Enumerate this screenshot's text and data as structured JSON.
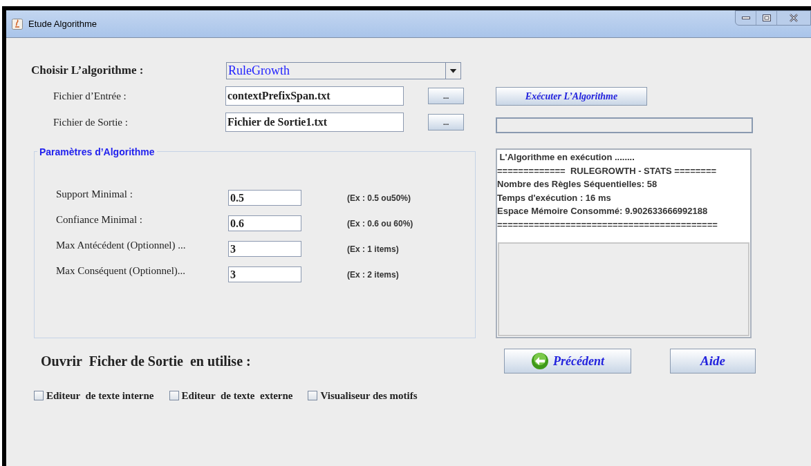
{
  "window": {
    "title": "Etude Algorithme"
  },
  "algorithm": {
    "label": "Choisir L’algorithme :",
    "value": "RuleGrowth"
  },
  "input_file": {
    "label": "Fichier d’Entrée :",
    "value": "contextPrefixSpan.txt",
    "browse": "..."
  },
  "output_file": {
    "label": "Fichier de Sortie :",
    "value": "Fichier de Sortie1.txt",
    "browse": "..."
  },
  "run_button": "Exécuter L’Algorithme",
  "parameters": {
    "title": "Paramètres d’Algorithme",
    "rows": [
      {
        "label": "Support Minimal :",
        "value": "0.5",
        "hint": "(Ex : 0.5 ou50%)"
      },
      {
        "label": "Confiance Minimal :",
        "value": "0.6",
        "hint": "(Ex : 0.6 ou 60%)"
      },
      {
        "label": "Max Antécédent (Optionnel) ...",
        "value": "3",
        "hint": "(Ex : 1 items)"
      },
      {
        "label": "Max Conséquent (Optionnel)...",
        "value": "3",
        "hint": "(Ex : 2 items)"
      }
    ]
  },
  "output_log": {
    "lines": [
      " L'Algorithme en exécution ........",
      "=============  RULEGROWTH - STATS ========",
      "Nombre des Règles Séquentielles: 58",
      "Temps d'exécution : 16 ms",
      "Espace Mémoire Consommé: 9.902633666992188",
      "=========================================="
    ]
  },
  "buttons": [
    {
      "kind": "back",
      "label": "Précédent"
    },
    {
      "kind": "help",
      "label": "Aide"
    }
  ],
  "open_output": {
    "label": "Ouvrir  Ficher de Sortie  en utilise :",
    "options": [
      {
        "label": "Editeur  de texte interne",
        "checked": false
      },
      {
        "label": "Editeur  de texte  externe",
        "checked": false
      },
      {
        "label": "Visualiseur des motifs",
        "checked": false
      }
    ]
  }
}
